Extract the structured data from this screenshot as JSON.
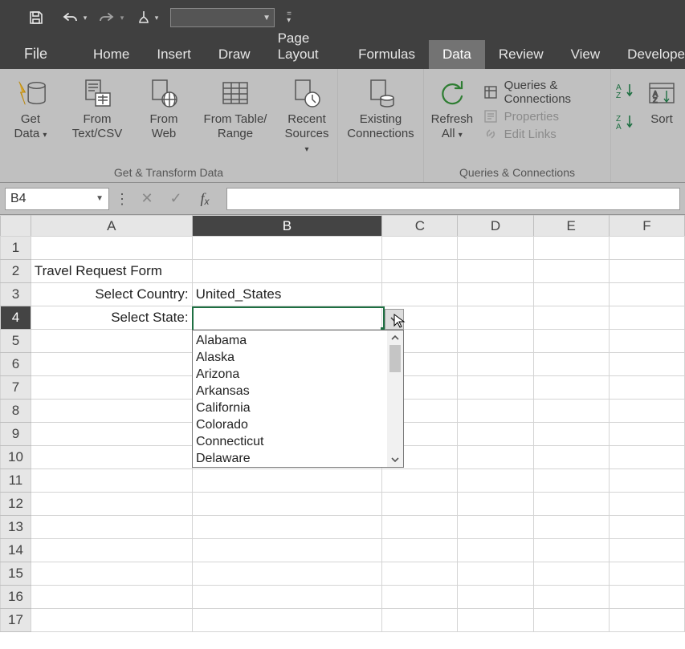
{
  "tabs": {
    "file": "File",
    "home": "Home",
    "insert": "Insert",
    "draw": "Draw",
    "page_layout": "Page Layout",
    "formulas": "Formulas",
    "data": "Data",
    "review": "Review",
    "view": "View",
    "developer": "Develope"
  },
  "ribbon": {
    "get_data": {
      "l1": "Get",
      "l2": "Data"
    },
    "from_csv": {
      "l1": "From",
      "l2": "Text/CSV"
    },
    "from_web": {
      "l1": "From",
      "l2": "Web"
    },
    "from_table": {
      "l1": "From Table/",
      "l2": "Range"
    },
    "recent_sources": {
      "l1": "Recent",
      "l2": "Sources"
    },
    "existing_conn": {
      "l1": "Existing",
      "l2": "Connections"
    },
    "refresh_all": {
      "l1": "Refresh",
      "l2": "All"
    },
    "queries": "Queries & Connections",
    "properties": "Properties",
    "edit_links": "Edit Links",
    "sort": "Sort",
    "group1": "Get & Transform Data",
    "group2": "Queries & Connections"
  },
  "name_box": "B4",
  "columns": [
    "A",
    "B",
    "C",
    "D",
    "E",
    "F"
  ],
  "rows": [
    "1",
    "2",
    "3",
    "4",
    "5",
    "6",
    "7",
    "8",
    "9",
    "10",
    "11",
    "12",
    "13",
    "14",
    "15",
    "16",
    "17"
  ],
  "cells": {
    "A2": "Travel Request Form",
    "A3": "Select Country:",
    "A4": "Select State:",
    "B3": "United_States"
  },
  "dropdown": {
    "items": [
      "Alabama",
      "Alaska",
      "Arizona",
      "Arkansas",
      "California",
      "Colorado",
      "Connecticut",
      "Delaware"
    ]
  }
}
